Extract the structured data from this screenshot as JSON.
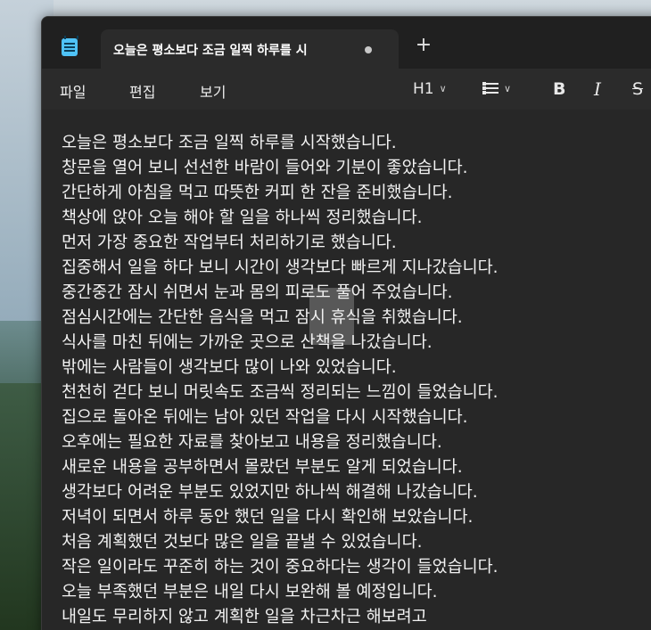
{
  "window": {
    "tab_title": "오늘은 평소보다 조금 일찍 하루를 시",
    "new_tab_label": "+"
  },
  "menu": {
    "file": "파일",
    "edit": "편집",
    "view": "보기"
  },
  "toolbar": {
    "heading": "H1",
    "bold": "B",
    "italic": "I",
    "strike": "S"
  },
  "document": {
    "lines": [
      "오늘은 평소보다 조금 일찍 하루를 시작했습니다.",
      "창문을 열어 보니 선선한 바람이 들어와 기분이 좋았습니다.",
      "간단하게 아침을 먹고 따뜻한 커피 한 잔을 준비했습니다.",
      "책상에 앉아 오늘 해야 할 일을 하나씩 정리했습니다.",
      "먼저 가장 중요한 작업부터 처리하기로 했습니다.",
      "집중해서 일을 하다 보니 시간이 생각보다 빠르게 지나갔습니다.",
      "중간중간 잠시 쉬면서 눈과 몸의 피로도 풀어 주었습니다.",
      "점심시간에는 간단한 음식을 먹고 잠시 휴식을 취했습니다.",
      "식사를 마친 뒤에는 가까운 곳으로 산책을 나갔습니다.",
      "밖에는 사람들이 생각보다 많이 나와 있었습니다.",
      "천천히 걷다 보니 머릿속도 조금씩 정리되는 느낌이 들었습니다.",
      "집으로 돌아온 뒤에는 남아 있던 작업을 다시 시작했습니다.",
      "오후에는 필요한 자료를 찾아보고 내용을 정리했습니다.",
      "새로운 내용을 공부하면서 몰랐던 부분도 알게 되었습니다.",
      "생각보다 어려운 부분도 있었지만 하나씩 해결해 나갔습니다.",
      "저녁이 되면서 하루 동안 했던 일을 다시 확인해 보았습니다.",
      "처음 계획했던 것보다 많은 일을 끝낼 수 있었습니다.",
      "작은 일이라도 꾸준히 하는 것이 중요하다는 생각이 들었습니다.",
      "오늘 부족했던 부분은 내일 다시 보완해 볼 예정입니다.",
      "내일도 무리하지 않고 계획한 일을 차근차근 해보려고"
    ]
  }
}
